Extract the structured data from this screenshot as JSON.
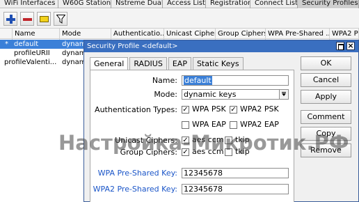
{
  "tabs": [
    "WiFi Interfaces",
    "W60G Station",
    "Nstreme Dual",
    "Access List",
    "Registration",
    "Connect List",
    "Security Profiles"
  ],
  "toolbar": {
    "icons": [
      "add-icon",
      "remove-icon",
      "comment-icon",
      "filter-icon"
    ],
    "colors": {
      "add": "#1f4fb3",
      "remove": "#c0262b",
      "comment": "#f2d21b"
    }
  },
  "list": {
    "columns": [
      "Name",
      "Mode",
      "Authenticatio...",
      "Unicast Ciphers",
      "Group Ciphers",
      "WPA Pre-Shared ...",
      "WPA2 Pr..."
    ],
    "rows": [
      {
        "marker": "*",
        "name": "default",
        "mode": "dynami"
      },
      {
        "marker": "",
        "name": "profileURII",
        "mode": "dynami"
      },
      {
        "marker": "",
        "name": "profileValenti...",
        "mode": "dynami"
      }
    ]
  },
  "dialog": {
    "title": "Security Profile <default>",
    "tabs": [
      "General",
      "RADIUS",
      "EAP",
      "Static Keys"
    ],
    "name_label": "Name:",
    "name_value": "default",
    "mode_label": "Mode:",
    "mode_value": "dynamic keys",
    "auth_label": "Authentication Types:",
    "auth": [
      {
        "label": "WPA PSK",
        "checked": true
      },
      {
        "label": "WPA2 PSK",
        "checked": true
      },
      {
        "label": "WPA EAP",
        "checked": false
      },
      {
        "label": "WPA2 EAP",
        "checked": false
      }
    ],
    "unicast_label": "Unicast Ciphers:",
    "group_label": "Group Ciphers:",
    "unicast": [
      {
        "label": "aes ccm",
        "checked": true
      },
      {
        "label": "tkip",
        "checked": false
      }
    ],
    "group": [
      {
        "label": "aes ccm",
        "checked": true
      },
      {
        "label": "tkip",
        "checked": false
      }
    ],
    "wpa_label": "WPA Pre-Shared Key:",
    "wpa_value": "12345678",
    "wpa2_label": "WPA2 Pre-Shared Key:",
    "wpa2_value": "12345678",
    "buttons": [
      "OK",
      "Cancel",
      "Apply",
      "Comment",
      "Copy",
      "Remove"
    ]
  },
  "watermark": "Настройка-Микротик.РФ"
}
